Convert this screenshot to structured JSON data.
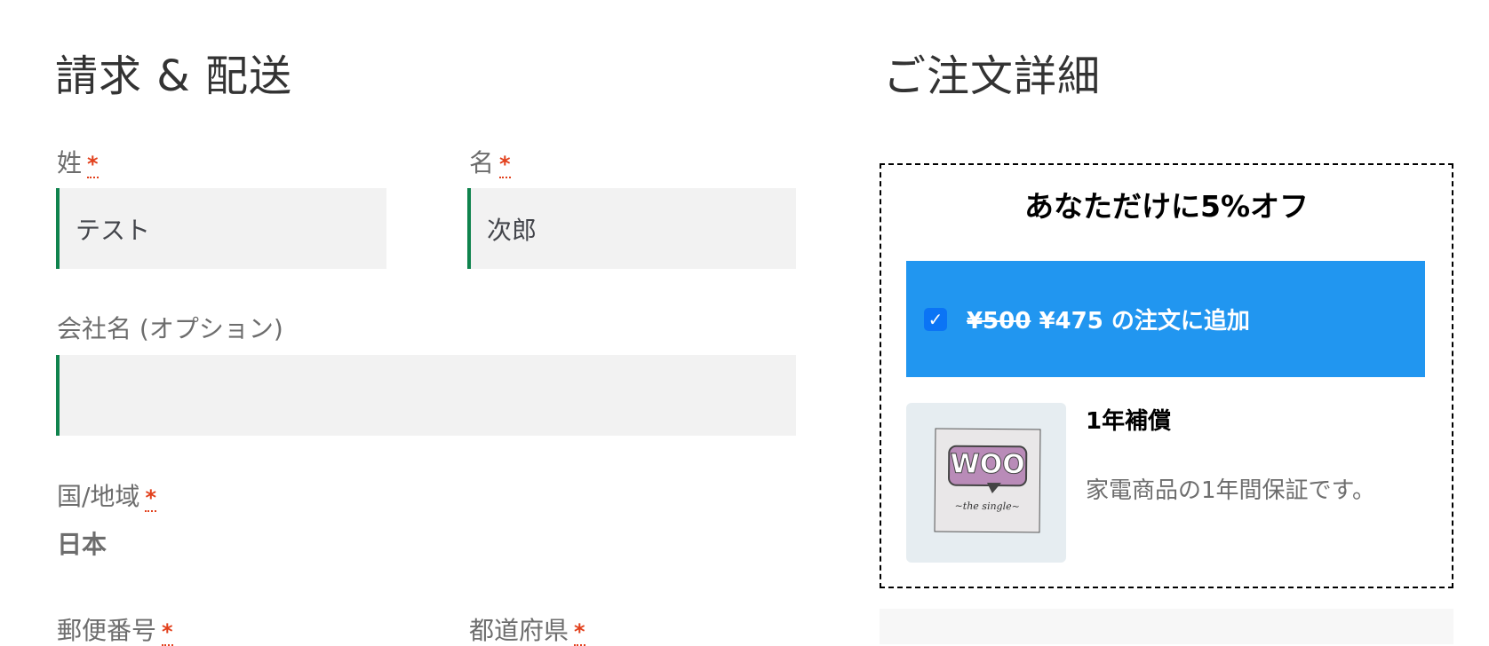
{
  "billing": {
    "heading": "請求 & 配送",
    "required_mark": "*",
    "fields": {
      "last_name": {
        "label": "姓",
        "value": "テスト"
      },
      "first_name": {
        "label": "名",
        "value": "次郎"
      },
      "company": {
        "label": "会社名 (オプション)",
        "value": ""
      },
      "country": {
        "label": "国/地域",
        "value": "日本"
      },
      "postcode": {
        "label": "郵便番号"
      },
      "state": {
        "label": "都道府県"
      }
    }
  },
  "order": {
    "heading": "ご注文詳細",
    "offer": {
      "title": "あなただけに5%オフ",
      "checked": true,
      "checkmark": "✓",
      "old_price": "¥500",
      "new_price": "¥475",
      "add_text": "の注文に追加",
      "accent_color": "#2196f0",
      "product": {
        "image_alt": "Woo the single",
        "image_text": "WOO",
        "image_caption": "~the  single~",
        "title": "1年補償",
        "description": "家電商品の1年間保証です。"
      }
    }
  }
}
